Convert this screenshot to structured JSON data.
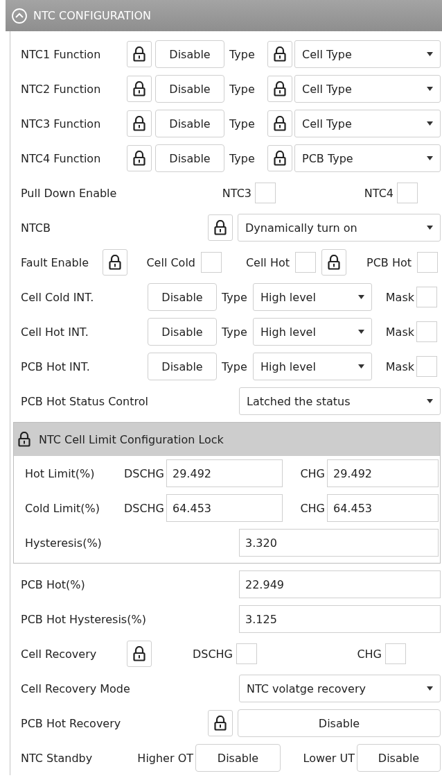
{
  "header": {
    "title": "NTC CONFIGURATION",
    "expanded": true
  },
  "functions": [
    {
      "label": "NTC1 Function",
      "value": "Disable",
      "type_label": "Type",
      "type_value": "Cell Type"
    },
    {
      "label": "NTC2 Function",
      "value": "Disable",
      "type_label": "Type",
      "type_value": "Cell Type"
    },
    {
      "label": "NTC3 Function",
      "value": "Disable",
      "type_label": "Type",
      "type_value": "Cell Type"
    },
    {
      "label": "NTC4 Function",
      "value": "Disable",
      "type_label": "Type",
      "type_value": "PCB Type"
    }
  ],
  "pull_down": {
    "label": "Pull Down Enable",
    "options": [
      {
        "label": "NTC3",
        "checked": false
      },
      {
        "label": "NTC4",
        "checked": false
      }
    ]
  },
  "ntcb": {
    "label": "NTCB",
    "value": "Dynamically turn on"
  },
  "fault_enable": {
    "label": "Fault Enable",
    "options": [
      {
        "label": "Cell Cold",
        "checked": false
      },
      {
        "label": "Cell Hot",
        "checked": false
      },
      {
        "label": "PCB Hot",
        "checked": false
      }
    ]
  },
  "interrupts": [
    {
      "label": "Cell Cold INT.",
      "value": "Disable",
      "type_label": "Type",
      "type_value": "High level",
      "mask_label": "Mask",
      "mask_checked": false
    },
    {
      "label": "Cell Hot INT.",
      "value": "Disable",
      "type_label": "Type",
      "type_value": "High level",
      "mask_label": "Mask",
      "mask_checked": false
    },
    {
      "label": "PCB Hot INT.",
      "value": "Disable",
      "type_label": "Type",
      "type_value": "High level",
      "mask_label": "Mask",
      "mask_checked": false
    }
  ],
  "pcb_status": {
    "label": "PCB Hot Status Control",
    "value": "Latched the status"
  },
  "cell_limit": {
    "title": "NTC Cell Limit Configuration Lock",
    "rows": [
      {
        "label": "Hot Limit(%)",
        "dschg_label": "DSCHG",
        "dschg": "29.492",
        "chg_label": "CHG",
        "chg": "29.492"
      },
      {
        "label": "Cold Limit(%)",
        "dschg_label": "DSCHG",
        "dschg": "64.453",
        "chg_label": "CHG",
        "chg": "64.453"
      }
    ],
    "hysteresis": {
      "label": "Hysteresis(%)",
      "value": "3.320"
    }
  },
  "pcb_hot": {
    "label": "PCB Hot(%)",
    "value": "22.949"
  },
  "pcb_hot_hysteresis": {
    "label": "PCB Hot Hysteresis(%)",
    "value": "3.125"
  },
  "cell_recovery": {
    "label": "Cell Recovery",
    "options": [
      {
        "label": "DSCHG",
        "checked": false
      },
      {
        "label": "CHG",
        "checked": false
      }
    ]
  },
  "recovery_mode": {
    "label": "Cell Recovery Mode",
    "value": "NTC volatge recovery"
  },
  "pcb_hot_recovery": {
    "label": "PCB Hot Recovery",
    "value": "Disable"
  },
  "standby": {
    "label": "NTC Standby",
    "items": [
      {
        "label": "Higher OT",
        "value": "Disable"
      },
      {
        "label": "Lower UT",
        "value": "Disable"
      }
    ]
  }
}
